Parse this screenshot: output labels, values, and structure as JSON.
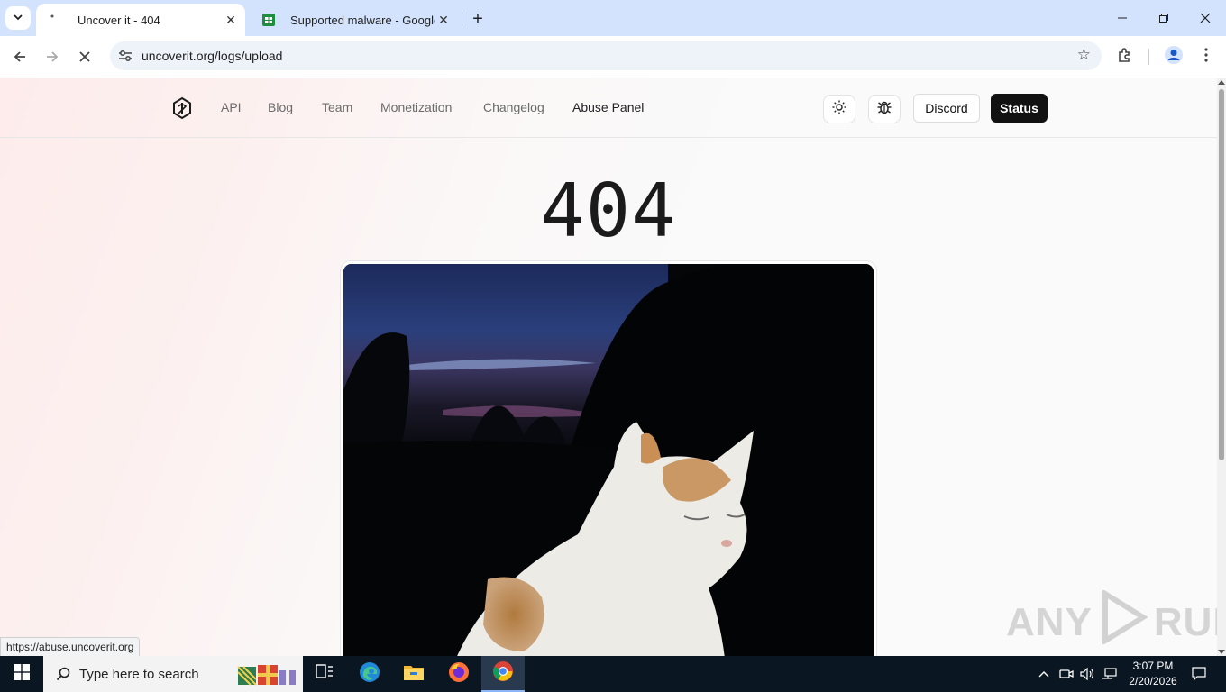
{
  "browser": {
    "tabs": [
      {
        "title": "Uncover it - 404",
        "active": true
      },
      {
        "title": "Supported malware - Google D",
        "active": false
      }
    ],
    "address": "uncoverit.org/logs/upload",
    "status_url": "https://abuse.uncoverit.org"
  },
  "site": {
    "nav": [
      "API",
      "Blog",
      "Team",
      "Monetization",
      "Changelog",
      "Abuse Panel"
    ],
    "buttons": {
      "discord": "Discord",
      "status": "Status"
    },
    "error_code": "404"
  },
  "watermark": {
    "left": "ANY",
    "right": "RUN"
  },
  "taskbar": {
    "search_placeholder": "Type here to search",
    "time": "3:07 PM",
    "date": "2/20/2026"
  },
  "colors": {
    "tabbar": "#d3e3fd",
    "taskbar": "#0b1623",
    "status_button": "#111111"
  }
}
